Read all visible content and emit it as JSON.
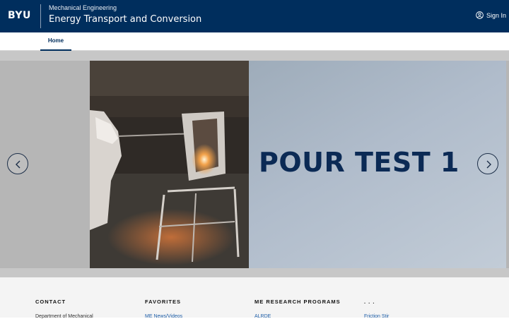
{
  "header": {
    "logo": "BYU",
    "department": "Mechanical Engineering",
    "site_title": "Energy Transport and Conversion",
    "signin_label": "Sign In",
    "colors": {
      "navy": "#002e5d",
      "white": "#ffffff"
    }
  },
  "nav": {
    "items": [
      {
        "label": "Home",
        "active": true
      }
    ]
  },
  "carousel": {
    "slide_caption": "POUR TEST 1",
    "prev_icon": "chevron-left-icon",
    "next_icon": "chevron-right-icon"
  },
  "footer": {
    "columns": [
      {
        "heading": "CONTACT",
        "first_line": "Department of Mechanical"
      },
      {
        "heading": "FAVORITES",
        "first_link": "ME News/Videos"
      },
      {
        "heading": "ME RESEARCH PROGRAMS",
        "first_link": "ALRDE"
      },
      {
        "heading": ". . .",
        "first_link": "Friction Stir"
      }
    ]
  }
}
